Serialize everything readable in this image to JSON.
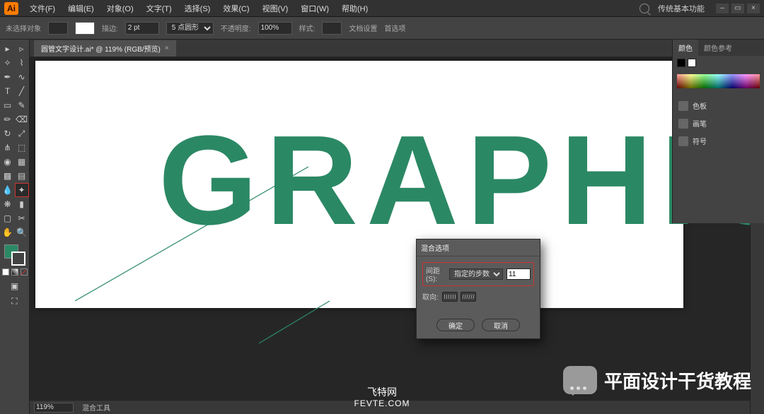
{
  "app": {
    "logo": "Ai",
    "workspace": "传统基本功能",
    "search_placeholder": ""
  },
  "menu": [
    "文件(F)",
    "编辑(E)",
    "对象(O)",
    "文字(T)",
    "选择(S)",
    "效果(C)",
    "视图(V)",
    "窗口(W)",
    "帮助(H)"
  ],
  "win": {
    "min": "–",
    "max": "▭",
    "close": "×"
  },
  "options": {
    "left_label": "未选择对象",
    "stroke_label": "描边:",
    "stroke_value": "2 pt",
    "brush_value": "5 点圆形",
    "opacity_label": "不透明度:",
    "opacity_value": "100%",
    "style_label": "样式:",
    "doc_setup": "文档设置",
    "prefs": "首选项"
  },
  "doc_tab": {
    "name": "圆管文字设计.ai* @ 119% (RGB/预览)",
    "close": "×"
  },
  "canvas_text": "GRAPHIC",
  "dialog": {
    "title": "混合选项",
    "spacing_label": "间距(S):",
    "spacing_mode": "指定的步数",
    "spacing_value": "11",
    "orient_label": "取向:",
    "ok": "确定",
    "cancel": "取消"
  },
  "panels": {
    "color_tabs": [
      "颜色",
      "颜色参考"
    ],
    "side_items": [
      {
        "icon": "layers",
        "label": "色板"
      },
      {
        "icon": "brush",
        "label": "画笔"
      },
      {
        "icon": "symbol",
        "label": "符号"
      }
    ]
  },
  "status": {
    "zoom": "119%",
    "tool": "混合工具"
  },
  "watermark": "平面设计干货教程",
  "footer": {
    "line1": "飞特网",
    "line2": "FEVTE.COM"
  }
}
